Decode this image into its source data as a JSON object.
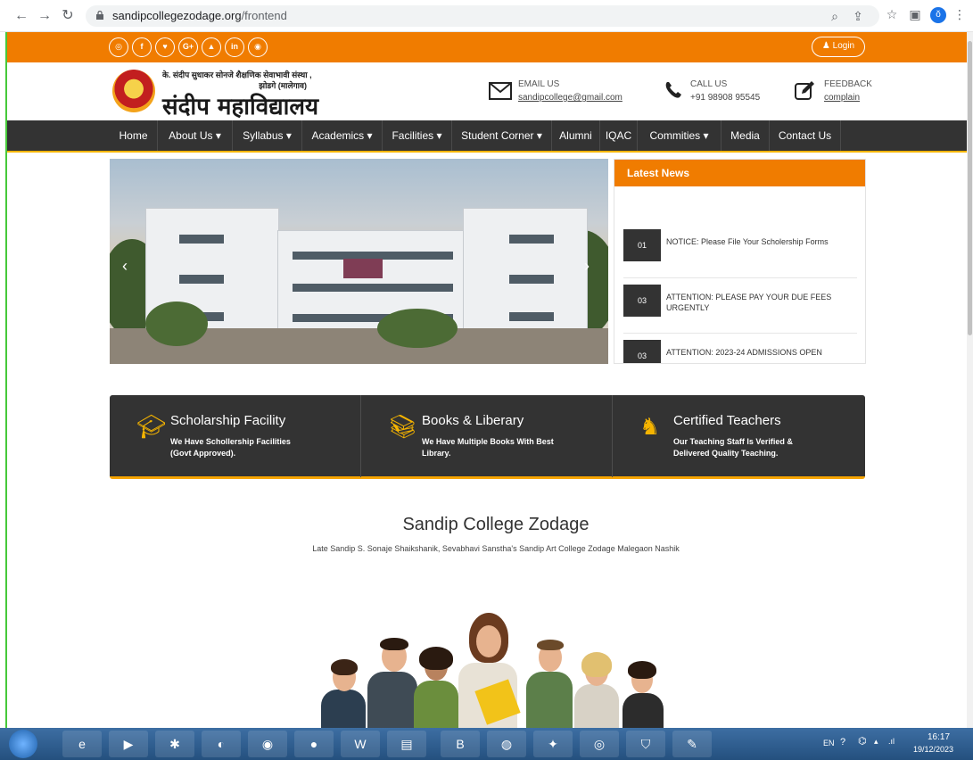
{
  "browser": {
    "url_domain": "sandipcollegezodage.org",
    "url_path": "/frontend"
  },
  "topbar": {
    "social": [
      "whatsapp-icon",
      "facebook-icon",
      "twitter-icon",
      "google-plus-icon",
      "youtube-icon",
      "linkedin-icon",
      "instagram-icon"
    ],
    "social_glyphs": [
      "◎",
      "f",
      "♥",
      "G+",
      "▲",
      "in",
      "◉"
    ],
    "login_label": "Login"
  },
  "header": {
    "logo_small_line1": "के. संदीप सुधाकर सोनजे शैक्षणिक सेवाभावी संस्था ,",
    "logo_small_line2": "झोडगे (मालेगाव)",
    "logo_big": "संदीप महाविद्यालय",
    "email_label": "EMAIL US",
    "email_value": "sandipcollege@gmail.com",
    "call_label": "CALL US",
    "call_value": "+91 98908 95545",
    "feedback_label": "FEEDBACK",
    "feedback_value": "complain"
  },
  "nav": {
    "items": [
      {
        "label": "Home"
      },
      {
        "label": "About Us ▾"
      },
      {
        "label": "Syllabus ▾"
      },
      {
        "label": "Academics ▾"
      },
      {
        "label": "Facilities ▾"
      },
      {
        "label": "Student Corner ▾"
      },
      {
        "label": "Alumni"
      },
      {
        "label": "IQAC"
      },
      {
        "label": "Commities ▾"
      },
      {
        "label": "Media"
      },
      {
        "label": "Contact Us"
      }
    ]
  },
  "news": {
    "title": "Latest News",
    "items": [
      {
        "num": "01",
        "text": "NOTICE: Please File Your Scholership Forms"
      },
      {
        "num": "03",
        "text": "ATTENTION: PLEASE PAY YOUR DUE FEES URGENTLY"
      },
      {
        "num": "03",
        "text": "ATTENTION: 2023-24 ADMISSIONS OPEN"
      }
    ]
  },
  "features": [
    {
      "title": "Scholarship Facility",
      "desc": "We Have Schollership Facilities (Govt Approved).",
      "icon": "graduation-cap-icon"
    },
    {
      "title": "Books & Liberary",
      "desc": "We Have Multiple Books With Best Library.",
      "icon": "books-icon"
    },
    {
      "title": "Certified Teachers",
      "desc": "Our Teaching Staff Is Verified & Delivered Quality Teaching.",
      "icon": "teacher-icon"
    }
  ],
  "intro": {
    "title": "Sandip College Zodage",
    "subtitle": "Late Sandip S. Sonaje Shaikshanik, Sevabhavi Sanstha's Sandip Art College Zodage Malegaon Nashik"
  },
  "taskbar": {
    "lang": "EN",
    "time": "16:17",
    "date": "19/12/2023"
  }
}
